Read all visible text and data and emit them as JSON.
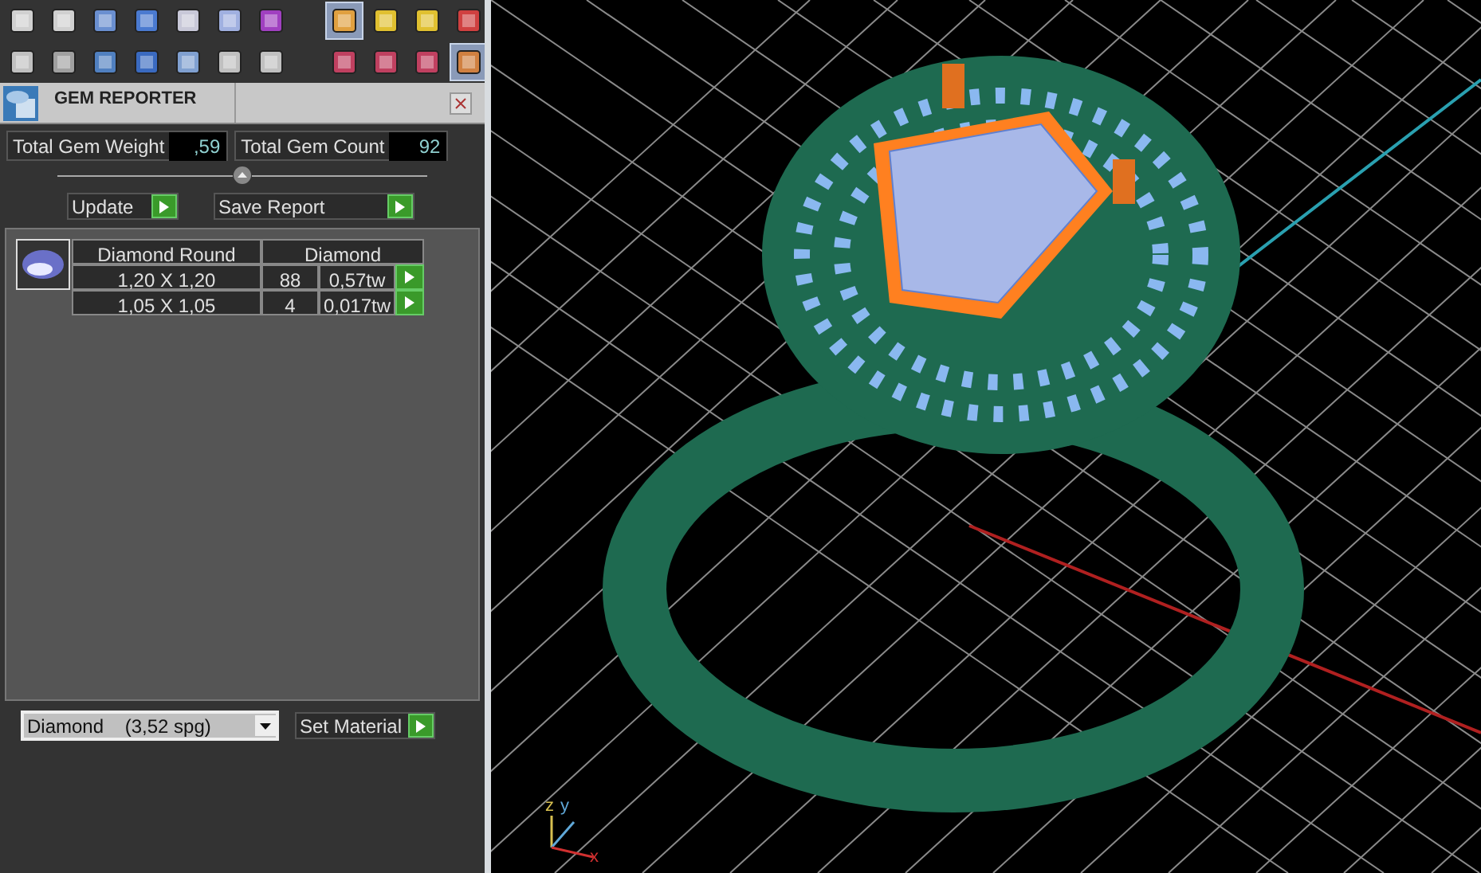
{
  "toolbars": [
    {
      "tools": [
        {
          "selected": false
        },
        {
          "selected": false
        },
        {
          "selected": false
        },
        {
          "selected": false
        },
        {
          "selected": false
        },
        {
          "selected": false
        },
        {
          "selected": false
        },
        {
          "selected": true
        },
        {
          "selected": false
        },
        {
          "selected": false
        },
        {
          "selected": false
        }
      ]
    },
    {
      "tools": [
        {
          "selected": false
        },
        {
          "selected": false
        },
        {
          "selected": false
        },
        {
          "selected": false
        },
        {
          "selected": false
        },
        {
          "selected": false
        },
        {
          "selected": false
        },
        {
          "selected": false
        },
        {
          "selected": false
        },
        {
          "selected": false
        },
        {
          "selected": true
        }
      ]
    }
  ],
  "panel": {
    "title": "GEM REPORTER"
  },
  "totals": [
    {
      "label": "Total Gem Weight",
      "value": ",59"
    },
    {
      "label": "Total Gem Count",
      "value": "92"
    }
  ],
  "buttons": [
    "Update",
    "Save Report"
  ],
  "gem_table": {
    "columns": [
      "Diamond Round",
      "Diamond"
    ],
    "rows": [
      {
        "size": "1,20 X 1,20",
        "count": "88",
        "weight": "0,57tw"
      },
      {
        "size": "1,05 X 1,05",
        "count": "4",
        "weight": "0,017tw"
      }
    ]
  },
  "material": {
    "value": "Diamond    (3,52 spg)",
    "button": "Set Material"
  },
  "viewport": {
    "axes": [
      {
        "label": "z",
        "color": "#d8c050"
      },
      {
        "label": "y",
        "color": "#60a8d8"
      },
      {
        "label": "x",
        "color": "#d03030"
      }
    ]
  }
}
